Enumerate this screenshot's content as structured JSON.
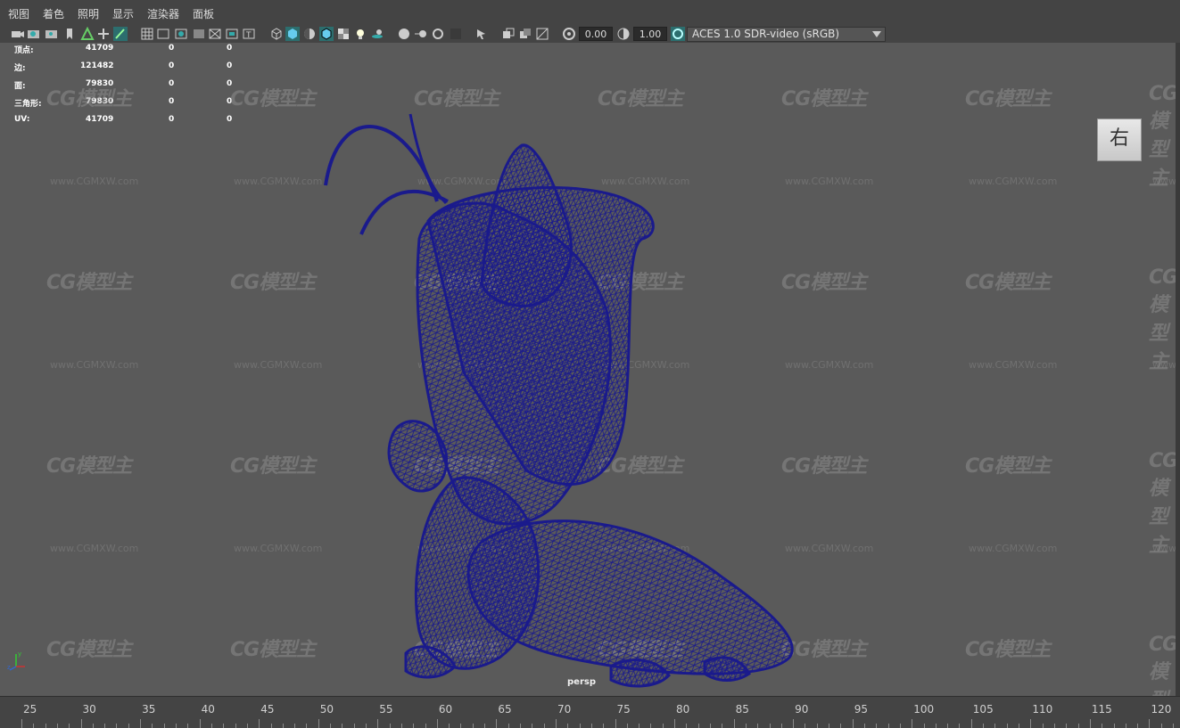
{
  "menubar": {
    "items": [
      "视图",
      "着色",
      "照明",
      "显示",
      "渲染器",
      "面板"
    ]
  },
  "toolbar": {
    "exposure_value": "0.00",
    "gamma_value": "1.00",
    "color_space": "ACES 1.0 SDR-video (sRGB)"
  },
  "hud": {
    "rows": [
      {
        "label": "顶点:",
        "v1": "41709",
        "v2": "0",
        "v3": "0"
      },
      {
        "label": "边:",
        "v1": "121482",
        "v2": "0",
        "v3": "0"
      },
      {
        "label": "面:",
        "v1": "79830",
        "v2": "0",
        "v3": "0"
      },
      {
        "label": "三角形:",
        "v1": "79830",
        "v2": "0",
        "v3": "0"
      },
      {
        "label": "UV:",
        "v1": "41709",
        "v2": "0",
        "v3": "0"
      }
    ]
  },
  "viewport": {
    "view_cube_label": "右",
    "camera_label": "persp",
    "watermark_logo": "CG模型主",
    "watermark_url": "www.CGMXW.com",
    "wireframe_color": "#1a1a8c",
    "background_color": "#5a5a5a"
  },
  "timeline": {
    "ticks": [
      "25",
      "30",
      "35",
      "40",
      "45",
      "50",
      "55",
      "60",
      "65",
      "70",
      "75",
      "80",
      "85",
      "90",
      "95",
      "100",
      "105",
      "110",
      "115",
      "120"
    ]
  }
}
